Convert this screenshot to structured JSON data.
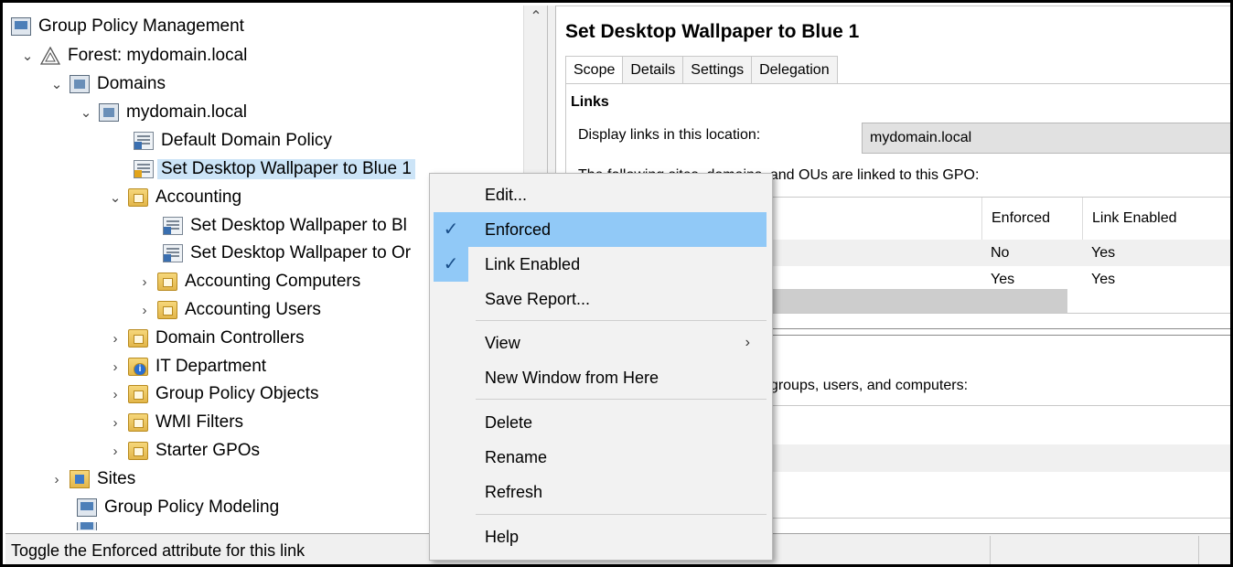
{
  "tree": {
    "root": "Group Policy Management",
    "forest": "Forest: mydomain.local",
    "domains": "Domains",
    "domain": "mydomain.local",
    "default_policy": "Default Domain Policy",
    "selected_gpo": "Set Desktop Wallpaper to Blue 1",
    "accounting": "Accounting",
    "acc_gpo_1": "Set Desktop Wallpaper to Bl",
    "acc_gpo_2": "Set Desktop Wallpaper to Or",
    "acc_computers": "Accounting Computers",
    "acc_users": "Accounting Users",
    "domain_controllers": "Domain Controllers",
    "it_department": "IT Department",
    "gpo_objects": "Group Policy Objects",
    "wmi_filters": "WMI Filters",
    "starter_gpos": "Starter GPOs",
    "sites": "Sites",
    "modeling": "Group Policy Modeling"
  },
  "detail": {
    "title": "Set Desktop Wallpaper to Blue 1",
    "tabs": [
      "Scope",
      "Details",
      "Settings",
      "Delegation"
    ],
    "links_heading": "Links",
    "display_links_label": "Display links in this location:",
    "display_links_value": "mydomain.local",
    "linked_text": "The following sites, domains, and OUs are linked to this GPO:",
    "table_headers": {
      "enforced": "Enforced",
      "link_enabled": "Link Enabled"
    },
    "rows": [
      {
        "enforced": "No",
        "link_enabled": "Yes"
      },
      {
        "enforced": "Yes",
        "link_enabled": "Yes"
      }
    ],
    "filter_text": "an only apply to the following groups, users, and computers:"
  },
  "context_menu": {
    "edit": "Edit...",
    "enforced": "Enforced",
    "link_enabled": "Link Enabled",
    "save_report": "Save Report...",
    "view": "View",
    "new_window": "New Window from Here",
    "delete": "Delete",
    "rename": "Rename",
    "refresh": "Refresh",
    "help": "Help"
  },
  "status_bar": {
    "text": "Toggle the Enforced attribute for this link"
  },
  "colors": {
    "menu_highlight": "#91c9f7",
    "selection": "#cce4f7"
  }
}
